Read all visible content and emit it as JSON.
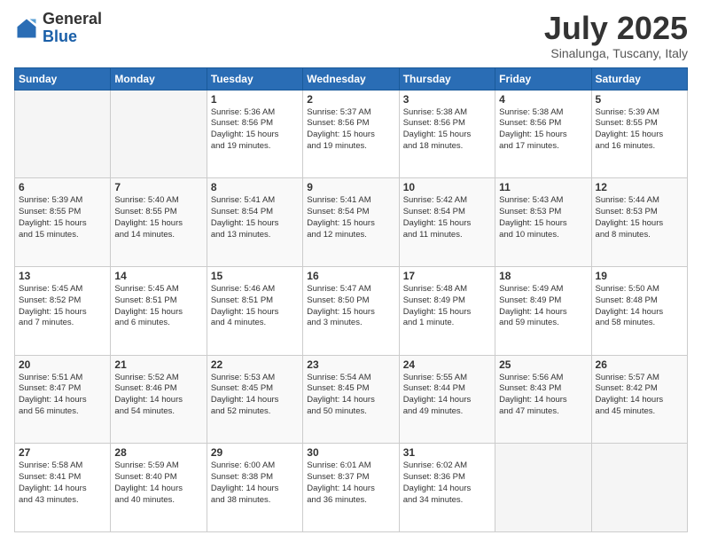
{
  "logo": {
    "general": "General",
    "blue": "Blue"
  },
  "header": {
    "month": "July 2025",
    "location": "Sinalunga, Tuscany, Italy"
  },
  "days_of_week": [
    "Sunday",
    "Monday",
    "Tuesday",
    "Wednesday",
    "Thursday",
    "Friday",
    "Saturday"
  ],
  "weeks": [
    [
      {
        "day": "",
        "content": ""
      },
      {
        "day": "",
        "content": ""
      },
      {
        "day": "1",
        "content": "Sunrise: 5:36 AM\nSunset: 8:56 PM\nDaylight: 15 hours\nand 19 minutes."
      },
      {
        "day": "2",
        "content": "Sunrise: 5:37 AM\nSunset: 8:56 PM\nDaylight: 15 hours\nand 19 minutes."
      },
      {
        "day": "3",
        "content": "Sunrise: 5:38 AM\nSunset: 8:56 PM\nDaylight: 15 hours\nand 18 minutes."
      },
      {
        "day": "4",
        "content": "Sunrise: 5:38 AM\nSunset: 8:56 PM\nDaylight: 15 hours\nand 17 minutes."
      },
      {
        "day": "5",
        "content": "Sunrise: 5:39 AM\nSunset: 8:55 PM\nDaylight: 15 hours\nand 16 minutes."
      }
    ],
    [
      {
        "day": "6",
        "content": "Sunrise: 5:39 AM\nSunset: 8:55 PM\nDaylight: 15 hours\nand 15 minutes."
      },
      {
        "day": "7",
        "content": "Sunrise: 5:40 AM\nSunset: 8:55 PM\nDaylight: 15 hours\nand 14 minutes."
      },
      {
        "day": "8",
        "content": "Sunrise: 5:41 AM\nSunset: 8:54 PM\nDaylight: 15 hours\nand 13 minutes."
      },
      {
        "day": "9",
        "content": "Sunrise: 5:41 AM\nSunset: 8:54 PM\nDaylight: 15 hours\nand 12 minutes."
      },
      {
        "day": "10",
        "content": "Sunrise: 5:42 AM\nSunset: 8:54 PM\nDaylight: 15 hours\nand 11 minutes."
      },
      {
        "day": "11",
        "content": "Sunrise: 5:43 AM\nSunset: 8:53 PM\nDaylight: 15 hours\nand 10 minutes."
      },
      {
        "day": "12",
        "content": "Sunrise: 5:44 AM\nSunset: 8:53 PM\nDaylight: 15 hours\nand 8 minutes."
      }
    ],
    [
      {
        "day": "13",
        "content": "Sunrise: 5:45 AM\nSunset: 8:52 PM\nDaylight: 15 hours\nand 7 minutes."
      },
      {
        "day": "14",
        "content": "Sunrise: 5:45 AM\nSunset: 8:51 PM\nDaylight: 15 hours\nand 6 minutes."
      },
      {
        "day": "15",
        "content": "Sunrise: 5:46 AM\nSunset: 8:51 PM\nDaylight: 15 hours\nand 4 minutes."
      },
      {
        "day": "16",
        "content": "Sunrise: 5:47 AM\nSunset: 8:50 PM\nDaylight: 15 hours\nand 3 minutes."
      },
      {
        "day": "17",
        "content": "Sunrise: 5:48 AM\nSunset: 8:49 PM\nDaylight: 15 hours\nand 1 minute."
      },
      {
        "day": "18",
        "content": "Sunrise: 5:49 AM\nSunset: 8:49 PM\nDaylight: 14 hours\nand 59 minutes."
      },
      {
        "day": "19",
        "content": "Sunrise: 5:50 AM\nSunset: 8:48 PM\nDaylight: 14 hours\nand 58 minutes."
      }
    ],
    [
      {
        "day": "20",
        "content": "Sunrise: 5:51 AM\nSunset: 8:47 PM\nDaylight: 14 hours\nand 56 minutes."
      },
      {
        "day": "21",
        "content": "Sunrise: 5:52 AM\nSunset: 8:46 PM\nDaylight: 14 hours\nand 54 minutes."
      },
      {
        "day": "22",
        "content": "Sunrise: 5:53 AM\nSunset: 8:45 PM\nDaylight: 14 hours\nand 52 minutes."
      },
      {
        "day": "23",
        "content": "Sunrise: 5:54 AM\nSunset: 8:45 PM\nDaylight: 14 hours\nand 50 minutes."
      },
      {
        "day": "24",
        "content": "Sunrise: 5:55 AM\nSunset: 8:44 PM\nDaylight: 14 hours\nand 49 minutes."
      },
      {
        "day": "25",
        "content": "Sunrise: 5:56 AM\nSunset: 8:43 PM\nDaylight: 14 hours\nand 47 minutes."
      },
      {
        "day": "26",
        "content": "Sunrise: 5:57 AM\nSunset: 8:42 PM\nDaylight: 14 hours\nand 45 minutes."
      }
    ],
    [
      {
        "day": "27",
        "content": "Sunrise: 5:58 AM\nSunset: 8:41 PM\nDaylight: 14 hours\nand 43 minutes."
      },
      {
        "day": "28",
        "content": "Sunrise: 5:59 AM\nSunset: 8:40 PM\nDaylight: 14 hours\nand 40 minutes."
      },
      {
        "day": "29",
        "content": "Sunrise: 6:00 AM\nSunset: 8:38 PM\nDaylight: 14 hours\nand 38 minutes."
      },
      {
        "day": "30",
        "content": "Sunrise: 6:01 AM\nSunset: 8:37 PM\nDaylight: 14 hours\nand 36 minutes."
      },
      {
        "day": "31",
        "content": "Sunrise: 6:02 AM\nSunset: 8:36 PM\nDaylight: 14 hours\nand 34 minutes."
      },
      {
        "day": "",
        "content": ""
      },
      {
        "day": "",
        "content": ""
      }
    ]
  ]
}
